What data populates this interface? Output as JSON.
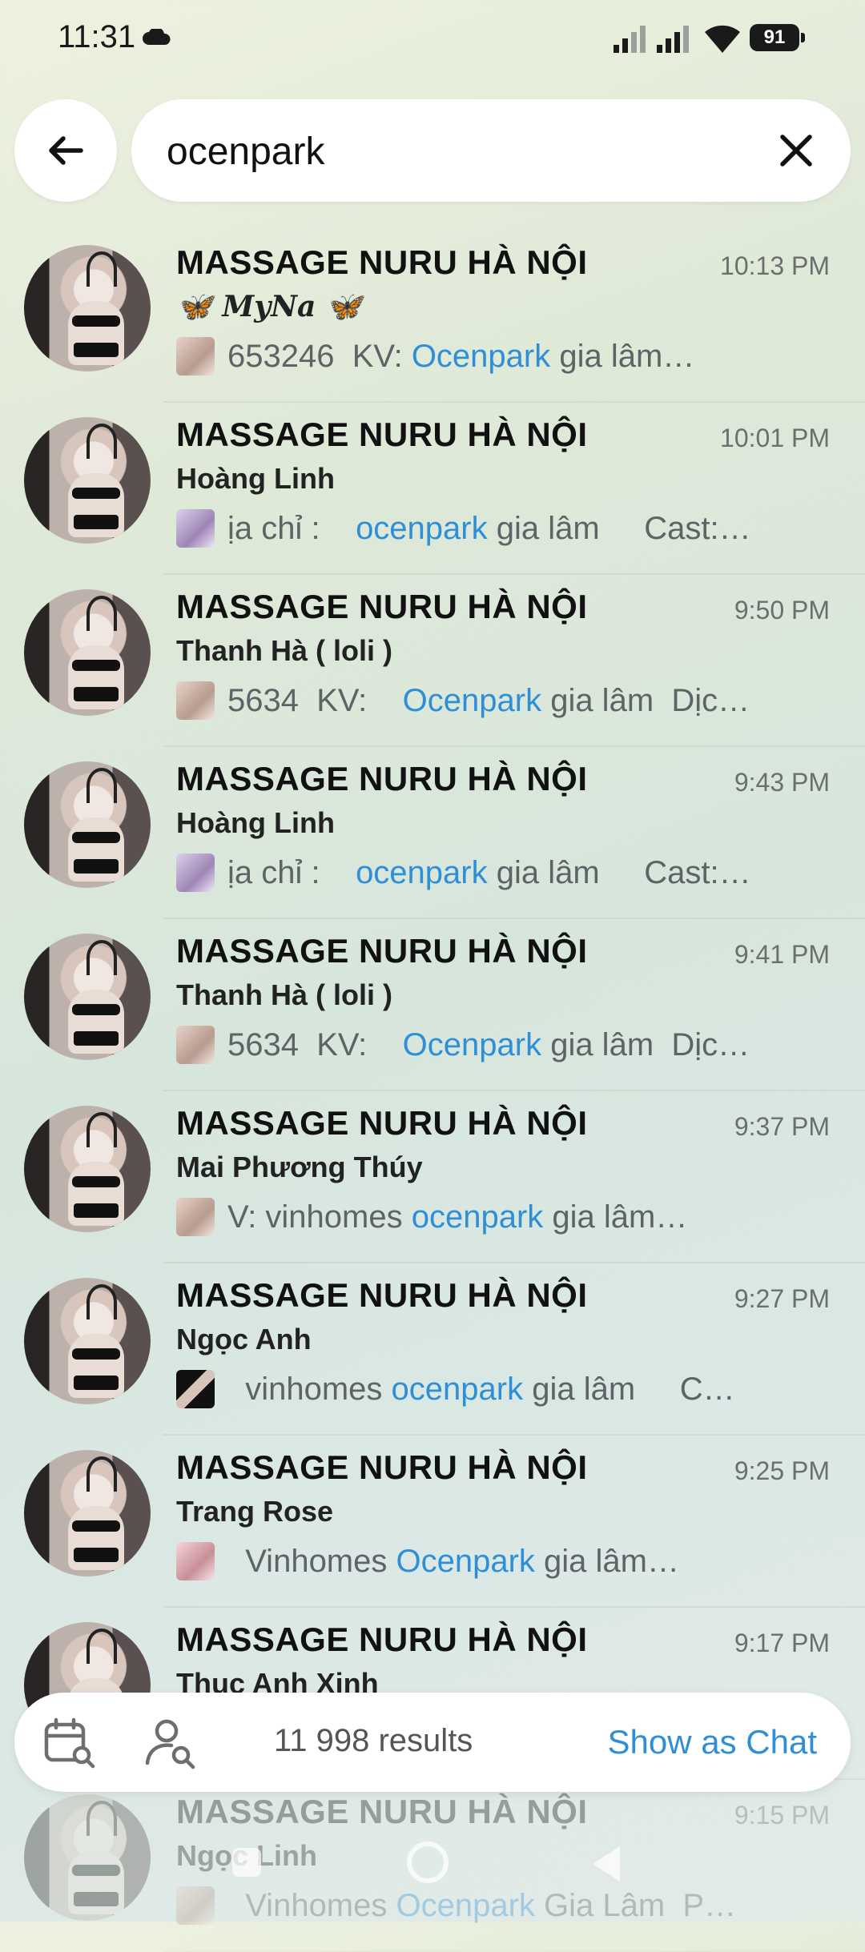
{
  "status_bar": {
    "time": "11:31",
    "battery": "91"
  },
  "search": {
    "query": "ocenpark"
  },
  "results": [
    {
      "title": "MASSAGE NURU HÀ NỘI",
      "time": "10:13 PM",
      "sender": "🦋 𝑴𝒚𝑵𝒂 🦋",
      "pre": "653246  KV: ",
      "match": "Ocenpark",
      "post": " gia lâm…",
      "thumb": "beige"
    },
    {
      "title": "MASSAGE NURU HÀ NỘI",
      "time": "10:01 PM",
      "sender": "Hoàng Linh",
      "pre": "ịa chỉ :    ",
      "match": "ocenpark",
      "post": " gia lâm     Cast:…",
      "thumb": "purple"
    },
    {
      "title": "MASSAGE NURU HÀ NỘI",
      "time": "9:50 PM",
      "sender": "Thanh Hà ( loli )",
      "pre": "5634  KV:    ",
      "match": "Ocenpark",
      "post": " gia lâm  Dịc…",
      "thumb": "beige"
    },
    {
      "title": "MASSAGE NURU HÀ NỘI",
      "time": "9:43 PM",
      "sender": "Hoàng Linh",
      "pre": "ịa chỉ :    ",
      "match": "ocenpark",
      "post": " gia lâm     Cast:…",
      "thumb": "purple"
    },
    {
      "title": "MASSAGE NURU HÀ NỘI",
      "time": "9:41 PM",
      "sender": "Thanh Hà ( loli )",
      "pre": "5634  KV:    ",
      "match": "Ocenpark",
      "post": " gia lâm  Dịc…",
      "thumb": "beige"
    },
    {
      "title": "MASSAGE NURU HÀ NỘI",
      "time": "9:37 PM",
      "sender": "Mai Phương Thúy",
      "pre": "V: vinhomes ",
      "match": "ocenpark",
      "post": " gia lâm…",
      "thumb": "beige"
    },
    {
      "title": "MASSAGE NURU HÀ NỘI",
      "time": "9:27 PM",
      "sender": "Ngọc Anh",
      "pre": "  vinhomes ",
      "match": "ocenpark",
      "post": " gia lâm     C…",
      "thumb": "dark"
    },
    {
      "title": "MASSAGE NURU HÀ NỘI",
      "time": "9:25 PM",
      "sender": "Trang Rose",
      "pre": "  Vinhomes ",
      "match": "Ocenpark",
      "post": " gia lâm…",
      "thumb": "pink"
    },
    {
      "title": "MASSAGE NURU HÀ NỘI",
      "time": "9:17 PM",
      "sender": "Thục Anh Xinh",
      "pre": "",
      "match": "",
      "post": "",
      "thumb": "beige"
    },
    {
      "title": "MASSAGE NURU HÀ NỘI",
      "time": "9:15 PM",
      "sender": "Ngọc Linh",
      "pre": "  Vinhomes ",
      "match": "Ocenpark",
      "post": " Gia Lâm  P…",
      "thumb": "beige"
    }
  ],
  "bottom_bar": {
    "results_count": "11 998 results",
    "show_as_chat": "Show as Chat"
  },
  "colors": {
    "accent": "#2f8fd6"
  }
}
